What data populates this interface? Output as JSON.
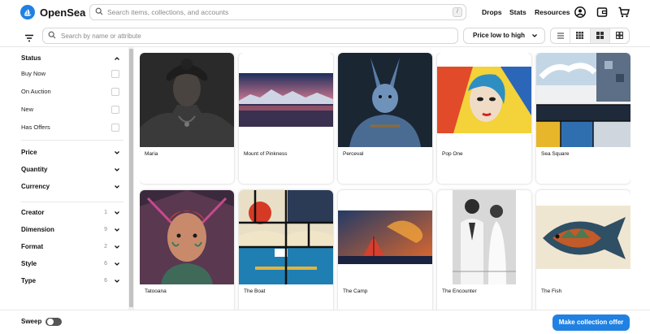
{
  "app": {
    "logo_text": "OpenSea",
    "search_placeholder": "Search items, collections, and accounts",
    "search_shortcut": "/"
  },
  "nav": {
    "drops": "Drops",
    "stats": "Stats",
    "resources": "Resources"
  },
  "toolbar": {
    "search_placeholder": "Search by name or attribute",
    "sort_label": "Price low to high"
  },
  "sidebar": {
    "status": {
      "title": "Status",
      "options": [
        "Buy Now",
        "On Auction",
        "New",
        "Has Offers"
      ]
    },
    "price": "Price",
    "quantity": "Quantity",
    "currency": "Currency",
    "traits": [
      {
        "name": "Creator",
        "count": "1"
      },
      {
        "name": "Dimension",
        "count": "9"
      },
      {
        "name": "Format",
        "count": "2"
      },
      {
        "name": "Style",
        "count": "6"
      },
      {
        "name": "Type",
        "count": "6"
      }
    ]
  },
  "items": [
    {
      "title": "Maria"
    },
    {
      "title": "Mount of Pinkness"
    },
    {
      "title": "Perceval"
    },
    {
      "title": "Pop One"
    },
    {
      "title": "Sea Square"
    },
    {
      "title": "Tatooana"
    },
    {
      "title": "The Boat"
    },
    {
      "title": "The Camp"
    },
    {
      "title": "The Encounter"
    },
    {
      "title": "The Fish"
    }
  ],
  "footer": {
    "sweep_label": "Sweep",
    "offer_button": "Make collection offer"
  },
  "colors": {
    "accent": "#2081e2"
  }
}
